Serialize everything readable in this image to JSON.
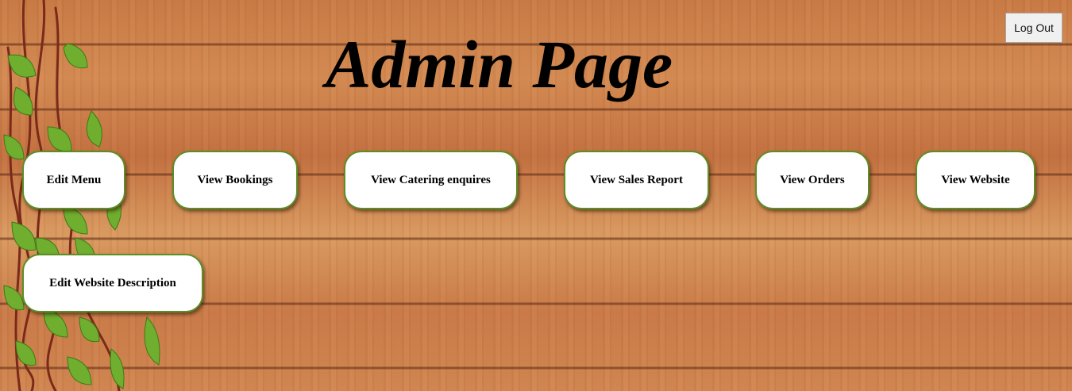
{
  "header": {
    "title": "Admin Page",
    "logout_label": "Log Out"
  },
  "nav": {
    "items": [
      {
        "label": "Edit Menu"
      },
      {
        "label": "View Bookings"
      },
      {
        "label": "View Catering enquires"
      },
      {
        "label": "View Sales Report"
      },
      {
        "label": "View Orders"
      },
      {
        "label": "View Website"
      },
      {
        "label": "Edit Website Description"
      }
    ]
  },
  "colors": {
    "button_border": "#5a8f24",
    "wood": "#c87a45"
  },
  "icons": {
    "decoration": "ivy-vine-icon"
  }
}
